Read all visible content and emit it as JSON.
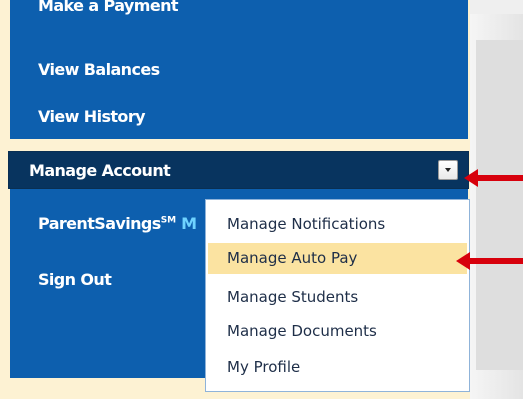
{
  "nav": {
    "top_items": [
      {
        "label": "Make a Payment"
      },
      {
        "label": "View Balances"
      },
      {
        "label": "View History"
      }
    ],
    "manage_account": {
      "label": "Manage Account"
    },
    "bottom_items": {
      "parent_savings": {
        "label": "ParentSavings",
        "sup": "SM",
        "tail": "M"
      },
      "sign_out": {
        "label": "Sign Out"
      }
    }
  },
  "menu": {
    "items": [
      {
        "label": "Manage Notifications"
      },
      {
        "label": "Manage Auto Pay",
        "highlighted": true
      },
      {
        "label": "Manage Students"
      },
      {
        "label": "Manage Documents"
      },
      {
        "label": "My Profile"
      }
    ]
  },
  "colors": {
    "nav_blue": "#0d5fae",
    "manage_dark": "#08345f",
    "menu_highlight": "#fbe3a1",
    "arrow_red": "#d7000c",
    "frame_yellow": "#fdf2d3"
  },
  "icons": {
    "dropdown": "chevron-down-icon",
    "pointer": "arrow-left-icon"
  }
}
